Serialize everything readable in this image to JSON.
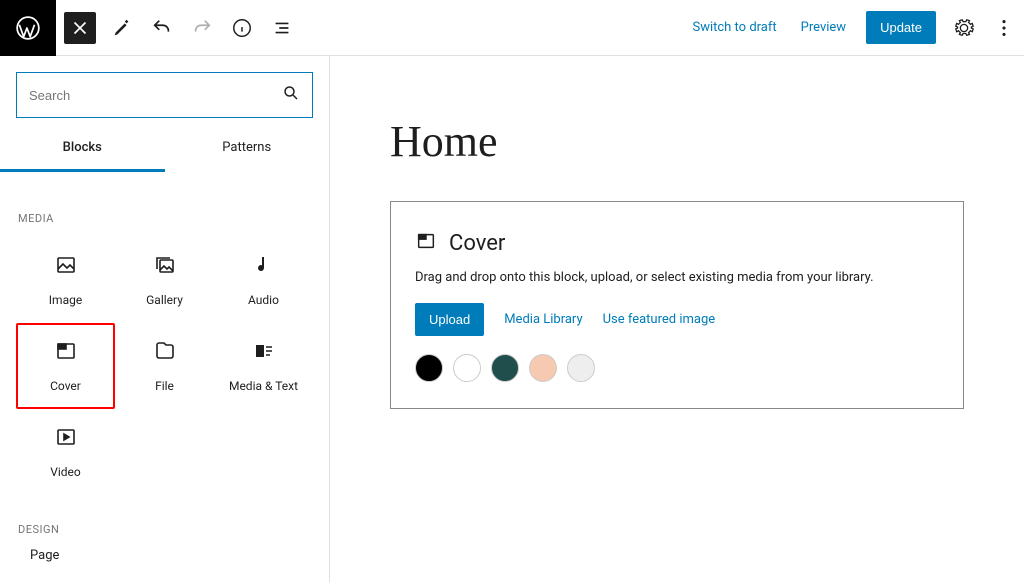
{
  "toolbar": {
    "switch_to_draft": "Switch to draft",
    "preview": "Preview",
    "update": "Update"
  },
  "inserter": {
    "search_placeholder": "Search",
    "tabs": {
      "blocks": "Blocks",
      "patterns": "Patterns"
    },
    "categories": {
      "media": {
        "title": "Media",
        "items": [
          "Image",
          "Gallery",
          "Audio",
          "Cover",
          "File",
          "Media & Text",
          "Video"
        ]
      },
      "design": {
        "title": "Design",
        "items": [
          "Page"
        ]
      }
    }
  },
  "canvas": {
    "page_title": "Home",
    "cover": {
      "label": "Cover",
      "instructions": "Drag and drop onto this block, upload, or select existing media from your library.",
      "upload": "Upload",
      "media_library": "Media Library",
      "featured": "Use featured image",
      "swatches": [
        "#000000",
        "#ffffff",
        "#1f4e4d",
        "#f6cab1",
        "#eeeeee"
      ]
    }
  }
}
